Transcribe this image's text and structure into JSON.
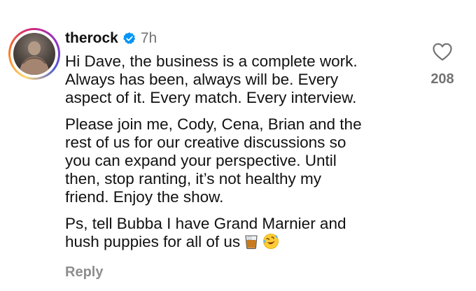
{
  "comment": {
    "username": "therock",
    "verified": true,
    "timestamp": "7h",
    "paragraphs": [
      "Hi Dave, the business is a complete work.\nAlways has been, always will be. Every\naspect of it. Every match. Every interview.",
      "Please join me, Cody, Cena, Brian and the\nrest of us for our creative discussions so\nyou can expand your perspective. Until\nthen, stop ranting, it’s not healthy my\nfriend. Enjoy the show.",
      "Ps, tell Bubba I have Grand Marnier and\nhush puppies for all of us"
    ],
    "emojis": [
      "tumbler-glass",
      "rolling-on-floor-laughing"
    ],
    "reply_label": "Reply",
    "like_count": "208"
  },
  "colors": {
    "verified_blue": "#0095f6",
    "muted_text": "#737373"
  }
}
